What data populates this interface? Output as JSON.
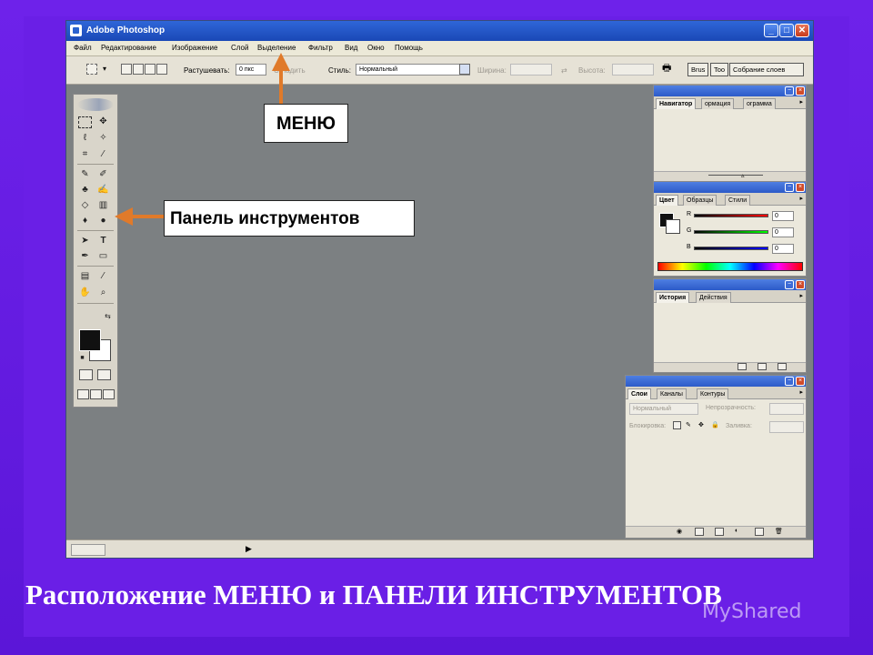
{
  "window": {
    "title": "Adobe Photoshop",
    "controls": {
      "minimize": "_",
      "maximize": "□",
      "close": "✕"
    }
  },
  "menubar": {
    "items": [
      "Файл",
      "Редактирование",
      "Изображение",
      "Слой",
      "Выделение",
      "Фильтр",
      "Вид",
      "Окно",
      "Помощь"
    ]
  },
  "options_bar": {
    "feather_label": "Растушевать:",
    "feather_value": "0 пкс",
    "antialias_label": "Сгладить",
    "style_label": "Стиль:",
    "style_value": "Нормальный",
    "width_label": "Ширина:",
    "height_label": "Высота:",
    "palette_tabs": [
      "Brus",
      "Too",
      "Собрание слоев"
    ]
  },
  "palettes": {
    "navigator": {
      "tabs": [
        "Навигатор",
        "ормация",
        "ограмма"
      ]
    },
    "color": {
      "tabs": [
        "Цвет",
        "Образцы",
        "Стили"
      ],
      "channels": [
        {
          "label": "R",
          "value": "0"
        },
        {
          "label": "G",
          "value": "0"
        },
        {
          "label": "B",
          "value": "0"
        }
      ]
    },
    "history": {
      "tabs": [
        "История",
        "Действия"
      ]
    },
    "layers": {
      "tabs": [
        "Слои",
        "Каналы",
        "Контуры"
      ],
      "blend_mode": "Нормальный",
      "opacity_label": "Непрозрачность:",
      "lock_label": "Блокировка:",
      "fill_label": "Заливка:"
    }
  },
  "annotations": {
    "menu_callout": "МЕНЮ",
    "tools_callout": "Панель инструментов",
    "accent_color": "#e07a2a"
  },
  "caption": "Расположение МЕНЮ и ПАНЕЛИ ИНСТРУМЕНТОВ",
  "watermark": "MyShared"
}
